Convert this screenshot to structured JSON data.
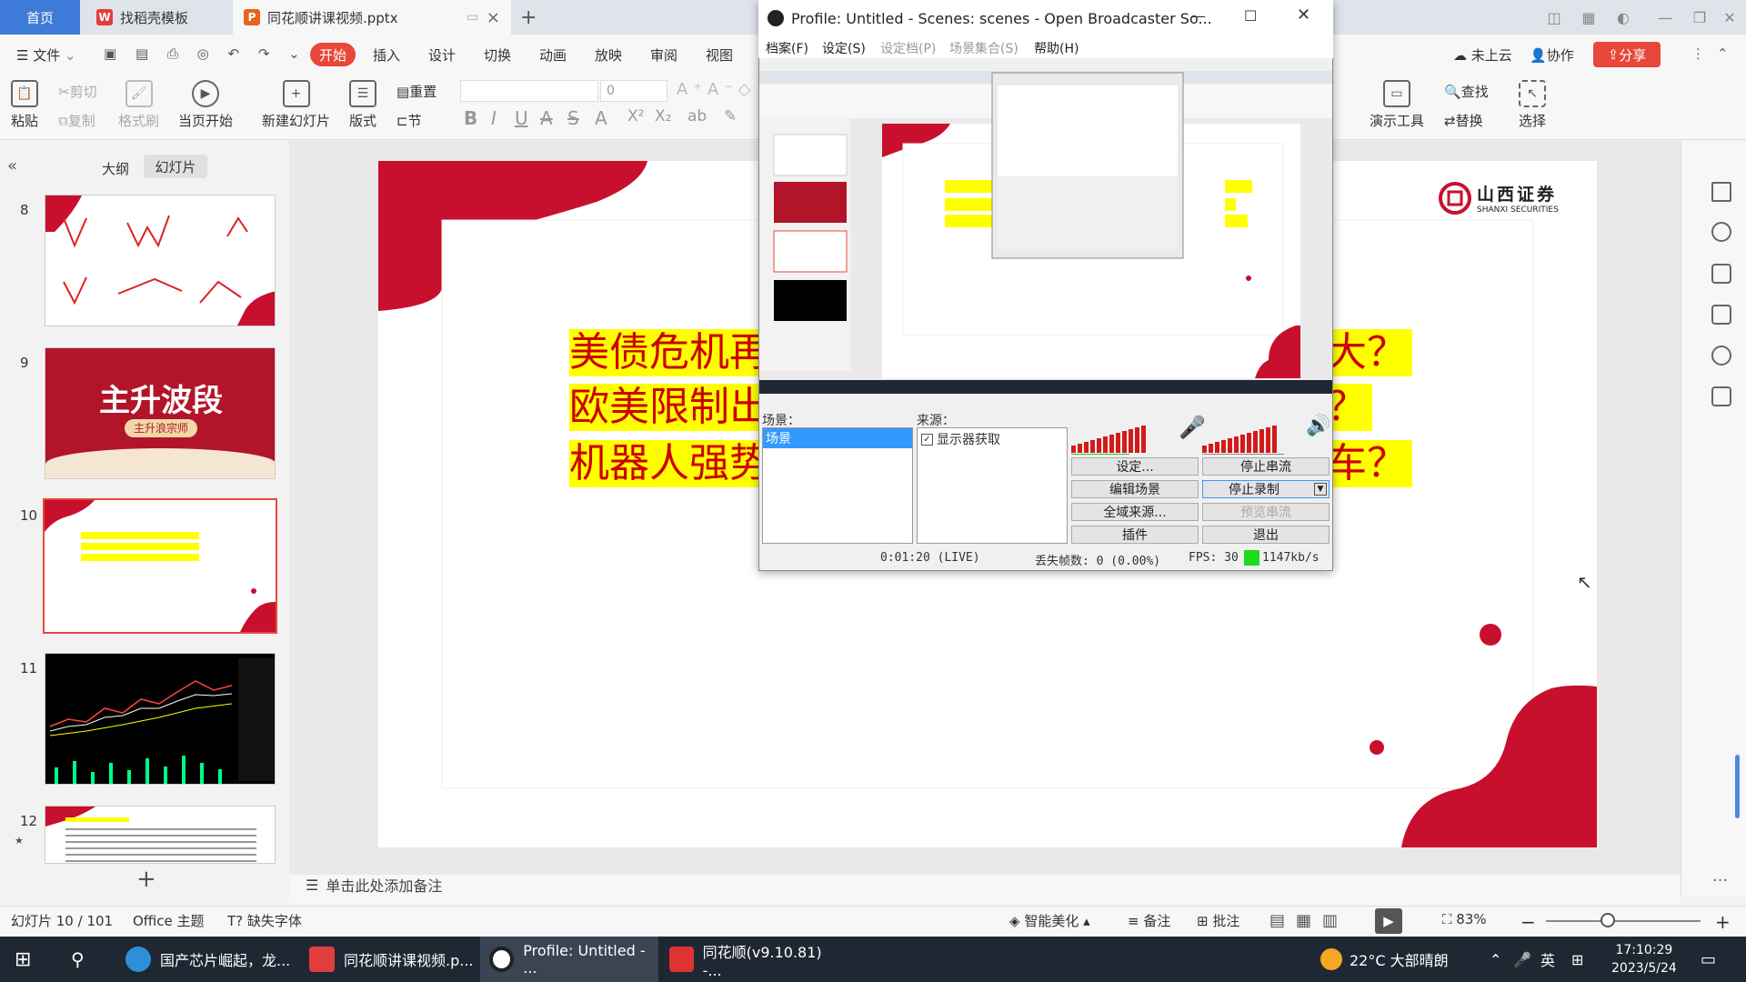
{
  "tabs": {
    "home": "首页",
    "template": "找稻壳模板",
    "document": "同花顺讲课视频.pptx",
    "new_tab": "+"
  },
  "menu": {
    "file": "文件",
    "items": [
      "开始",
      "插入",
      "设计",
      "切换",
      "动画",
      "放映",
      "审阅",
      "视图"
    ],
    "cloud": "未上云",
    "collab": "协作",
    "share": "分享"
  },
  "ribbon": {
    "paste": "粘贴",
    "cut": "剪切",
    "copy": "复制",
    "format_painter": "格式刷",
    "play_from_current": "当页开始",
    "new_slide": "新建幻灯片",
    "layout": "版式",
    "reset": "重置",
    "section": "节",
    "font_size": "0",
    "presentation_tools": "演示工具",
    "find": "查找",
    "replace": "替换",
    "select": "选择"
  },
  "left_panel": {
    "outline_tab": "大纲",
    "slides_tab": "幻灯片",
    "collapse": "«",
    "add": "+",
    "slides": [
      {
        "number": "8"
      },
      {
        "number": "9",
        "title": "主升波段",
        "subtitle": "主升浪宗师"
      },
      {
        "number": "10"
      },
      {
        "number": "11"
      },
      {
        "number": "12"
      }
    ]
  },
  "slide": {
    "logo_cn": "山西证券",
    "logo_en": "SHANXI SECURITIES",
    "lines": [
      {
        "left": "美债危机再",
        "right": "大？"
      },
      {
        "left": "欧美限制出",
        "right": "？"
      },
      {
        "left": "机器人强势",
        "right": "车？"
      }
    ]
  },
  "notes_placeholder": "单击此处添加备注",
  "status": {
    "slide_counter": "幻灯片 10 / 101",
    "theme": "Office 主题",
    "missing_font": "缺失字体",
    "beautify": "智能美化",
    "notes": "备注",
    "comments": "批注",
    "zoom": "83%"
  },
  "taskbar": {
    "items": [
      {
        "label": "国产芯片崛起，龙..."
      },
      {
        "label": "同花顺讲课视频.p..."
      },
      {
        "label": "Profile: Untitled - ..."
      },
      {
        "label": "同花顺(v9.10.81) -..."
      }
    ],
    "weather": "22°C 大部晴朗",
    "ime": "英",
    "time": "17:10:29",
    "date": "2023/5/24"
  },
  "obs": {
    "title": "Profile: Untitled - Scenes: scenes - Open Broadcaster So...",
    "menu": [
      "档案(F)",
      "设定(S)",
      "设定档(P)",
      "场景集合(S)",
      "帮助(H)"
    ],
    "scenes_label": "场景：",
    "scene_item": "场景",
    "sources_label": "来源：",
    "source_item": "显示器获取",
    "buttons": {
      "settings": "设定...",
      "stop_stream": "停止串流",
      "edit_scene": "编辑场景",
      "stop_record": "停止录制",
      "global_sources": "全域来源...",
      "preview_stream": "预览串流",
      "plugins": "插件",
      "exit": "退出"
    },
    "status": {
      "time": "0:01:20 (LIVE)",
      "dropped": "丢失帧数: 0 (0.00%)",
      "fps": "FPS: 30",
      "bitrate": "1147kb/s"
    }
  },
  "colors": {
    "accent": "#e8473a",
    "slide_red": "#c8102e",
    "highlight": "#ffff00",
    "taskbar": "#1f2733"
  }
}
